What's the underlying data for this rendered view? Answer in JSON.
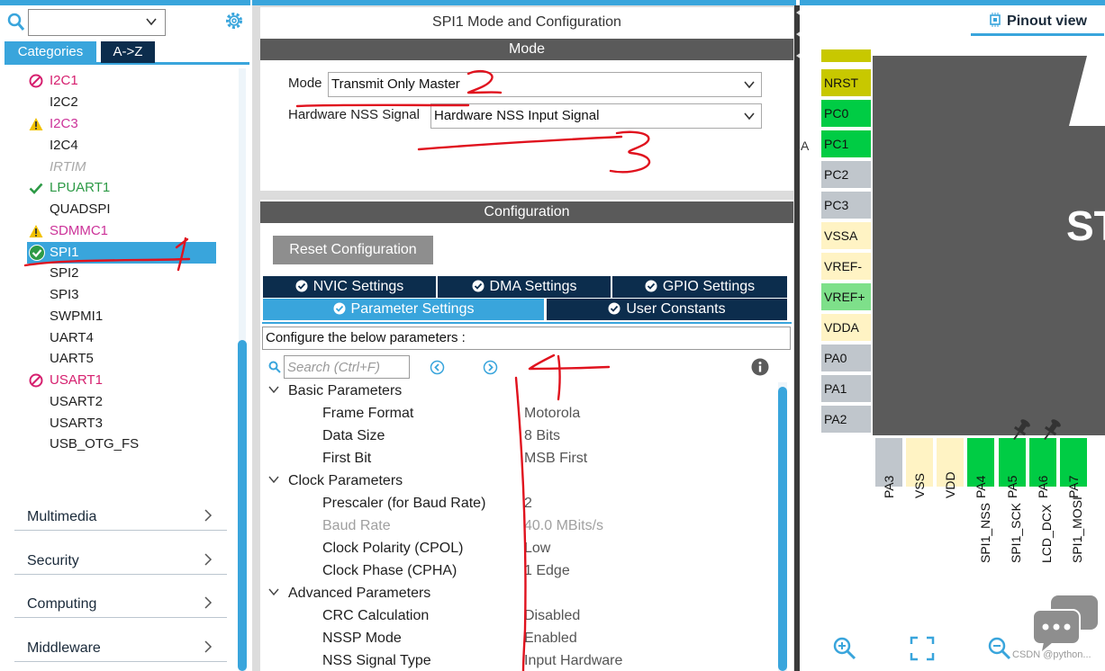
{
  "left": {
    "search_value": "",
    "tabs": {
      "categories": "Categories",
      "az": "A->Z"
    },
    "tree": [
      {
        "label": "I2C1",
        "status": "error"
      },
      {
        "label": "I2C2",
        "status": "normal"
      },
      {
        "label": "I2C3",
        "status": "warning"
      },
      {
        "label": "I2C4",
        "status": "normal"
      },
      {
        "label": "IRTIM",
        "status": "disabled"
      },
      {
        "label": "LPUART1",
        "status": "ok"
      },
      {
        "label": "QUADSPI",
        "status": "normal"
      },
      {
        "label": "SDMMC1",
        "status": "warning"
      },
      {
        "label": "SPI1",
        "status": "ok-selected"
      },
      {
        "label": "SPI2",
        "status": "normal"
      },
      {
        "label": "SPI3",
        "status": "normal"
      },
      {
        "label": "SWPMI1",
        "status": "normal"
      },
      {
        "label": "UART4",
        "status": "normal"
      },
      {
        "label": "UART5",
        "status": "normal"
      },
      {
        "label": "USART1",
        "status": "error"
      },
      {
        "label": "USART2",
        "status": "normal"
      },
      {
        "label": "USART3",
        "status": "normal"
      },
      {
        "label": "USB_OTG_FS",
        "status": "normal"
      }
    ],
    "categories": [
      "Multimedia",
      "Security",
      "Computing",
      "Middleware"
    ]
  },
  "middle": {
    "title": "SPI1 Mode and Configuration",
    "mode_band": "Mode",
    "mode_label": "Mode",
    "mode_value": "Transmit Only Master",
    "nss_label": "Hardware NSS Signal",
    "nss_value": "Hardware NSS Input Signal",
    "config_band": "Configuration",
    "reset_button": "Reset Configuration",
    "tabs": {
      "nvic": "NVIC Settings",
      "dma": "DMA Settings",
      "gpio": "GPIO Settings",
      "param": "Parameter Settings",
      "user": "User Constants"
    },
    "hint": "Configure the below parameters :",
    "search_placeholder": "Search (Ctrl+F)",
    "groups": {
      "basic": "Basic Parameters",
      "clock": "Clock Parameters",
      "advanced": "Advanced Parameters"
    },
    "params": {
      "frame_format": {
        "name": "Frame Format",
        "value": "Motorola"
      },
      "data_size": {
        "name": "Data Size",
        "value": "8 Bits"
      },
      "first_bit": {
        "name": "First Bit",
        "value": "MSB First"
      },
      "prescaler": {
        "name": "Prescaler (for Baud Rate)",
        "value": "2"
      },
      "baud_rate": {
        "name": "Baud Rate",
        "value": "40.0 MBits/s"
      },
      "cpol": {
        "name": "Clock Polarity (CPOL)",
        "value": "Low"
      },
      "cpha": {
        "name": "Clock Phase (CPHA)",
        "value": "1 Edge"
      },
      "crc": {
        "name": "CRC Calculation",
        "value": "Disabled"
      },
      "nssp": {
        "name": "NSSP Mode",
        "value": "Enabled"
      },
      "nss_type": {
        "name": "NSS Signal Type",
        "value": "Input Hardware"
      }
    }
  },
  "right": {
    "tab": "Pinout view",
    "chip_text": "ST",
    "left_pins": [
      {
        "label": "NRST",
        "color": "#c8c800"
      },
      {
        "label": "PC0",
        "color": "#00cc44"
      },
      {
        "label": "PC1",
        "color": "#00cc44"
      },
      {
        "label": "PC2",
        "color": "#c0c6cc"
      },
      {
        "label": "PC3",
        "color": "#c0c6cc"
      },
      {
        "label": "VSSA",
        "color": "#fff3c4"
      },
      {
        "label": "VREF-",
        "color": "#fff3c4"
      },
      {
        "label": "VREF+",
        "color": "#7ee08a"
      },
      {
        "label": "VDDA",
        "color": "#fff3c4"
      },
      {
        "label": "PA0",
        "color": "#c0c6cc"
      },
      {
        "label": "PA1",
        "color": "#c0c6cc"
      },
      {
        "label": "PA2",
        "color": "#c0c6cc"
      }
    ],
    "bottom_pins": [
      {
        "label": "PA3",
        "color": "#c0c6cc"
      },
      {
        "label": "VSS",
        "color": "#fff3c4"
      },
      {
        "label": "VDD",
        "color": "#fff3c4"
      },
      {
        "label": "PA4",
        "color": "#00cc44"
      },
      {
        "label": "PA5",
        "color": "#00cc44"
      },
      {
        "label": "PA6",
        "color": "#00cc44"
      },
      {
        "label": "PA7",
        "color": "#00cc44"
      }
    ],
    "signals": [
      "SPI1_NSS",
      "SPI1_SCK",
      "LCD_DCX",
      "SPI1_MOSI"
    ],
    "side_letter": "A",
    "watermark": "CSDN @python..."
  },
  "colors": {
    "accent": "#39a5dc",
    "navy": "#0c2d4d",
    "band": "#5a5a5a",
    "annotation": "#e0121e"
  }
}
